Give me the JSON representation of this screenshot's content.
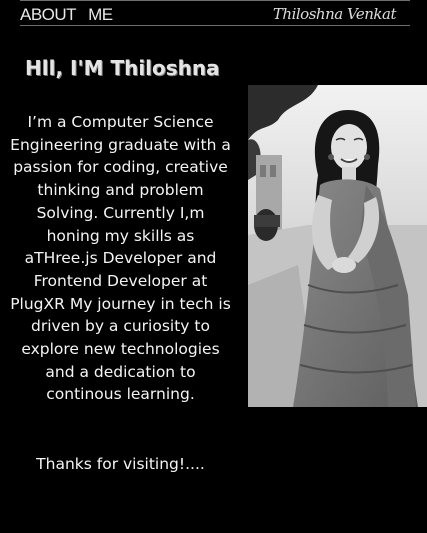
{
  "nav": {
    "items": [
      "ABOUT",
      "ME"
    ],
    "brand": "Thiloshna  Venkat"
  },
  "main": {
    "heading": "Hll, I'M Thiloshna",
    "bio": "I’m a Computer Science Engineering graduate with a passion for coding, creative thinking and problem Solving. Currently I,m honing my skills as aTHree.js Developer and Frontend Developer at PlugXR My journey in tech is driven by a curiosity to explore new technologies and a dedication to continous learning.",
    "thanks": "Thanks for visiting!...."
  },
  "colors": {
    "background": "#000000",
    "text": "#f4f4f4",
    "divider": "#6e6e6e"
  }
}
